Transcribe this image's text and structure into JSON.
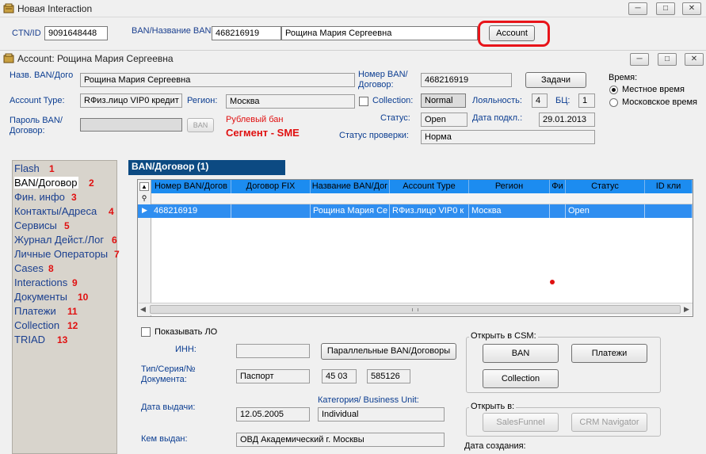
{
  "window": {
    "title": "Новая Interaction",
    "min": "─",
    "max": "□",
    "close": "✕"
  },
  "top": {
    "ctn_label": "CTN/ID",
    "ctn_value": "9091648448",
    "ban_label": "BAN/Название BAN",
    "ban_value": "468216919",
    "ban_name": "Рощина Мария Сергеевна",
    "account_button": "Account"
  },
  "account_window": {
    "title": "Account: Рощина Мария Сергеевна",
    "min": "─",
    "max": "□",
    "close": "✕"
  },
  "form": {
    "name_label": "Назв. BAN/Дого",
    "name_value": "Рощина Мария Сергеевна",
    "account_type_label": "Account Type:",
    "account_type_value": "RФиз.лицо  VIP0  кредит",
    "region_label": "Регион:",
    "region_value": "Москва",
    "password_label": "Пароль BAN/ Договор:",
    "ban_small_button": "BAN",
    "ruble_ban": "Рублевый бан",
    "segment": "Сегмент - SME",
    "ban_number_label": "Номер BAN/ Договор:",
    "ban_number_value": "468216919",
    "tasks_button": "Задачи",
    "collection_label": "Collection:",
    "collection_value": "Normal",
    "loyalty_label": "Лояльность:",
    "loyalty_value": "4",
    "bc_label": "БЦ:",
    "bc_value": "1",
    "status_label": "Статус:",
    "status_value": "Open",
    "connect_date_label": "Дата подкл.:",
    "connect_date_value": "29.01.2013",
    "check_status_label": "Статус проверки:",
    "check_status_value": "Норма",
    "time_label": "Время:",
    "time_local": "Местное время",
    "time_moscow": "Московское время"
  },
  "nav": [
    {
      "label": "Flash",
      "num": "1"
    },
    {
      "label": "BAN/Договор",
      "num": "2"
    },
    {
      "label": "Фин. инфо",
      "num": "3"
    },
    {
      "label": "Контакты/Адреса",
      "num": "4"
    },
    {
      "label": "Сервисы",
      "num": "5"
    },
    {
      "label": "Журнал Дейст./Лог",
      "num": "6"
    },
    {
      "label": "Личные Операторы",
      "num": "7"
    },
    {
      "label": "Cases",
      "num": "8"
    },
    {
      "label": "Interactions",
      "num": "9"
    },
    {
      "label": "Документы",
      "num": "10"
    },
    {
      "label": "Платежи",
      "num": "11"
    },
    {
      "label": "Collection",
      "num": "12"
    },
    {
      "label": "TRIAD",
      "num": "13"
    }
  ],
  "grid": {
    "title": "BAN/Договор (1)",
    "columns": [
      "Номер BAN/Догов",
      "Договор FIX",
      "Название BAN/Дог",
      "Account Type",
      "Регион",
      "Фи",
      "Статус",
      "ID кли"
    ],
    "rows": [
      [
        "468216919",
        "",
        "Рощина Мария Се",
        "RФиз.лицо  VIP0  к",
        "Москва",
        "",
        "Open",
        ""
      ]
    ]
  },
  "bottom": {
    "show_lo": "Показывать ЛО",
    "inn_label": "ИНН:",
    "parallel_button": "Параллельные BAN/Договоры",
    "doc_type_label": "Тип/Серия/№ Документа:",
    "doc_type": "Паспорт",
    "doc_series": "45 03",
    "doc_number": "585126",
    "issue_date_label": "Дата выдачи:",
    "issue_date": "12.05.2005",
    "category_label": "Категория/ Business Unit:",
    "category_value": "Individual",
    "issued_by_label": "Кем выдан:",
    "issued_by": "ОВД Академический г. Москвы",
    "open_csm_title": "Открыть в CSM:",
    "csm_ban": "BAN",
    "csm_payments": "Платежи",
    "csm_collection": "Collection",
    "open_in_title": "Открыть в:",
    "salesfunnel": "SalesFunnel",
    "crm_navigator": "CRM Navigator",
    "created_label": "Дата создания:"
  }
}
